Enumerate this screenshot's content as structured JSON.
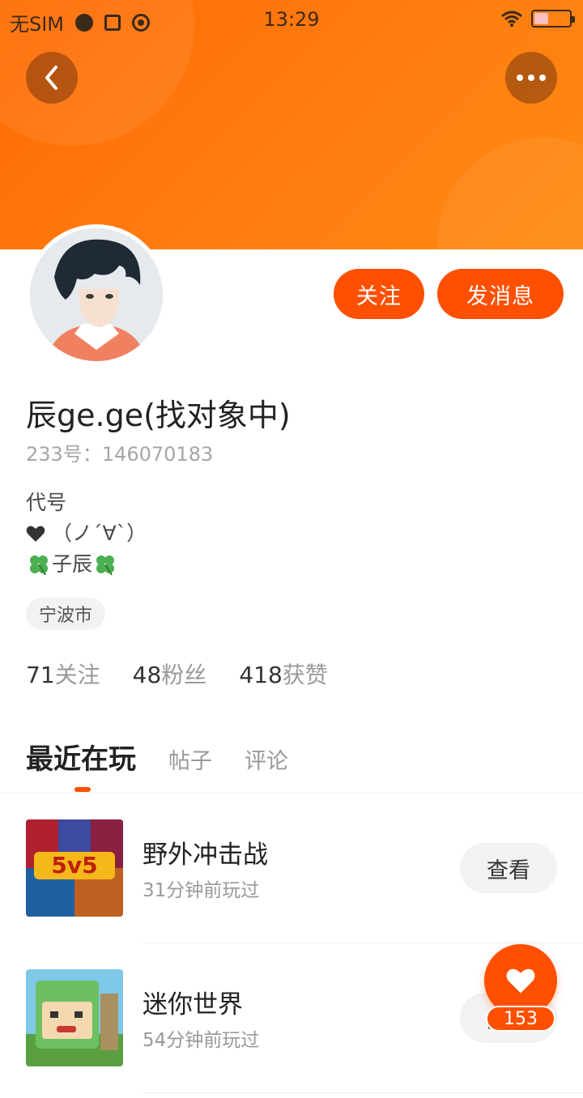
{
  "status_bar": {
    "carrier": "无SIM",
    "time": "13:29"
  },
  "header": {
    "back_icon": "chevron-left-icon",
    "more_icon": "more-horizontal-icon"
  },
  "actions": {
    "follow_label": "关注",
    "message_label": "发消息"
  },
  "profile": {
    "name": "辰ge.ge(找对象中)",
    "id_label": "233号：",
    "id_value": "146070183",
    "bio_line1": "代号",
    "bio_line2": "（ノ´∀`）",
    "bio_line3": "子辰",
    "location": "宁波市"
  },
  "stats": [
    {
      "num": "71",
      "label": "关注"
    },
    {
      "num": "48",
      "label": "粉丝"
    },
    {
      "num": "418",
      "label": "获赞"
    }
  ],
  "tabs": [
    "最近在玩",
    "帖子",
    "评论"
  ],
  "games": [
    {
      "title": "野外冲击战",
      "sub": "31分钟前玩过",
      "button": "查看"
    },
    {
      "title": "迷你世界",
      "sub": "54分钟前玩过",
      "button": "查看"
    }
  ],
  "fab": {
    "icon": "heart-icon",
    "count": "153"
  },
  "colors": {
    "accent": "#fe5000",
    "header_start": "#ff6a00",
    "header_end": "#ff8a12"
  }
}
